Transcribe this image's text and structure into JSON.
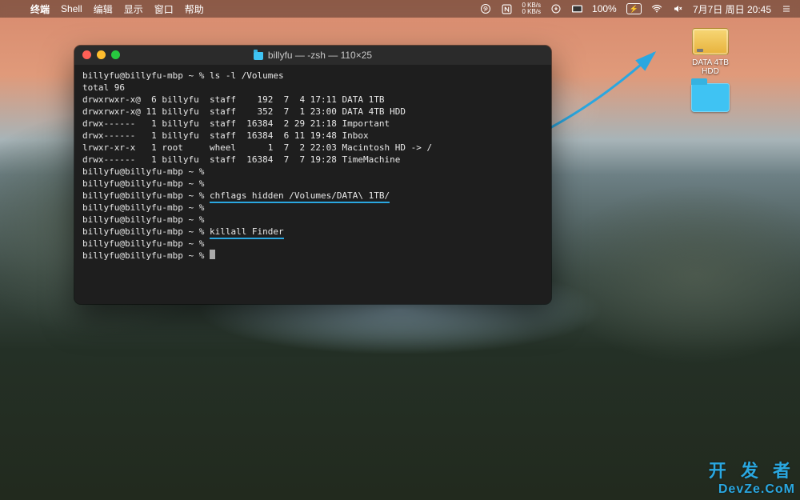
{
  "menubar": {
    "apple": "",
    "app": "终端",
    "items": [
      "Shell",
      "编辑",
      "显示",
      "窗口",
      "帮助"
    ],
    "net": {
      "up": "0 KB/s",
      "down": "0 KB/s"
    },
    "battery_pct": "100%",
    "clock": "7月7日 周日  20:45"
  },
  "desktop": {
    "drive_label": "DATA 4TB HDD",
    "folder_label": ""
  },
  "terminal": {
    "title": "billyfu — -zsh — 110×25",
    "prompt": "billyfu@billyfu-mbp ~ %",
    "lines": {
      "cmd_ls": "ls -l /Volumes",
      "total": "total 96",
      "row1": "drwxrwxr-x@  6 billyfu  staff    192  7  4 17:11 DATA 1TB",
      "row2": "drwxrwxr-x@ 11 billyfu  staff    352  7  1 23:00 DATA 4TB HDD",
      "row3": "drwx------   1 billyfu  staff  16384  2 29 21:18 Important",
      "row4": "drwx------   1 billyfu  staff  16384  6 11 19:48 Inbox",
      "row5": "lrwxr-xr-x   1 root     wheel      1  7  2 22:03 Macintosh HD -> /",
      "row6": "drwx------   1 billyfu  staff  16384  7  7 19:28 TimeMachine",
      "cmd_chflags": "chflags hidden /Volumes/DATA\\ 1TB/",
      "cmd_killall": "killall Finder"
    }
  },
  "watermark": {
    "l1": "开 发 者",
    "l2": "DevZe.CoM"
  },
  "colors": {
    "accent_underline": "#2aa7e0"
  }
}
